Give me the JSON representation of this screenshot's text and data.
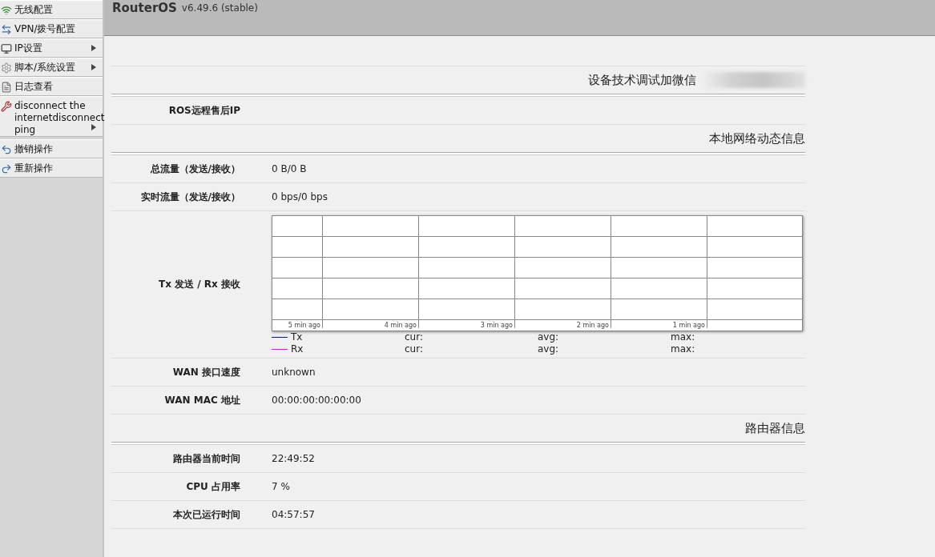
{
  "sidebar": {
    "groups": [
      {
        "items": [
          {
            "kind": "wireless",
            "label": "无线配置",
            "submenu": false
          },
          {
            "kind": "vpn",
            "label": "VPN/拨号配置",
            "submenu": false
          },
          {
            "kind": "ip",
            "label": "IP设置",
            "submenu": true
          },
          {
            "kind": "system",
            "label": "脚本/系统设置",
            "submenu": true
          },
          {
            "kind": "log",
            "label": "日志查看",
            "submenu": false
          },
          {
            "kind": "tools",
            "label": "disconnect the internetdisconnect ping",
            "submenu": true
          }
        ]
      },
      {
        "items": [
          {
            "kind": "undo",
            "label": "撤销操作",
            "submenu": false
          },
          {
            "kind": "redo",
            "label": "重新操作",
            "submenu": false
          }
        ]
      }
    ]
  },
  "header": {
    "title": "RouterOS",
    "version": "v6.49.6 (stable)"
  },
  "content": [
    {
      "kind": "blank"
    },
    {
      "kind": "section",
      "title": "设备技术调试加微信",
      "redacted": true
    },
    {
      "kind": "field",
      "label": "ROS远程售后IP"
    },
    {
      "kind": "section",
      "title": "本地网络动态信息"
    },
    {
      "kind": "field",
      "label": "总流量（发送/接收）",
      "value": "0 B/0 B"
    },
    {
      "kind": "field",
      "label": "实时流量（发送/接收）",
      "value": "0 bps/0 bps"
    },
    {
      "kind": "graph",
      "label": "Tx 发送 / Rx 接收",
      "time_labels": [
        "5 min ago",
        "4 min ago",
        "3 min ago",
        "2 min ago",
        "1 min ago"
      ],
      "legend": [
        {
          "name": "Tx",
          "color": "#0000ff",
          "cur": "cur:",
          "avg": "avg:",
          "max": "max:"
        },
        {
          "name": "Rx",
          "color": "#ff00ff",
          "cur": "cur:",
          "avg": "avg:",
          "max": "max:"
        }
      ]
    },
    {
      "kind": "field",
      "label": "WAN 接口速度",
      "value": "unknown"
    },
    {
      "kind": "field",
      "label": "WAN MAC 地址",
      "value": "00:00:00:00:00:00"
    },
    {
      "kind": "section",
      "title": "路由器信息"
    },
    {
      "kind": "field",
      "label": "路由器当前时间",
      "value": "22:49:52"
    },
    {
      "kind": "field",
      "label": "CPU 占用率",
      "value": "7 %"
    },
    {
      "kind": "field",
      "label": "本次已运行时间",
      "value": "04:57:57"
    }
  ]
}
